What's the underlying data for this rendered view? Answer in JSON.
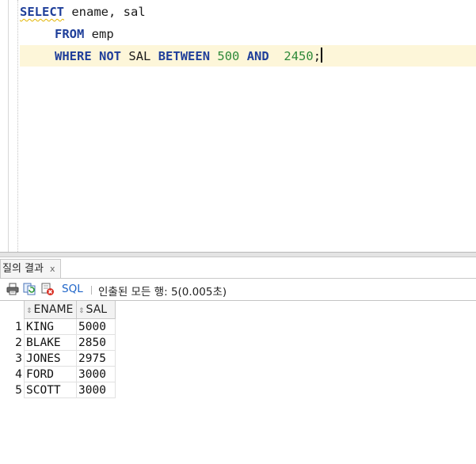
{
  "editor": {
    "line1": {
      "kw_select": "SELECT",
      "columns": " ename, sal"
    },
    "line2": {
      "kw_from": "FROM",
      "table": " emp"
    },
    "line3": {
      "kw_where": "WHERE",
      "kw_not": "NOT",
      "col": "SAL",
      "kw_between": "BETWEEN",
      "low": "500",
      "kw_and": "AND",
      "high": "2450",
      "terminator": ";"
    }
  },
  "results_tab": {
    "label": "질의 결과",
    "close": "x"
  },
  "toolbar": {
    "icons": [
      "print-icon",
      "refresh-icon",
      "clear-icon"
    ],
    "sql_label": "SQL",
    "status": "인출된 모든 행: 5(0.005초)"
  },
  "grid": {
    "columns": [
      "ENAME",
      "SAL"
    ],
    "rows": [
      {
        "num": "1",
        "ename": "KING",
        "sal": "5000"
      },
      {
        "num": "2",
        "ename": "BLAKE",
        "sal": "2850"
      },
      {
        "num": "3",
        "ename": "JONES",
        "sal": "2975"
      },
      {
        "num": "4",
        "ename": "FORD",
        "sal": "3000"
      },
      {
        "num": "5",
        "ename": "SCOTT",
        "sal": "3000"
      }
    ]
  },
  "colors": {
    "keyword": "#1f3f9a",
    "number": "#2e8a3a",
    "current_line": "#fdf6d9",
    "link": "#1e64c8"
  }
}
